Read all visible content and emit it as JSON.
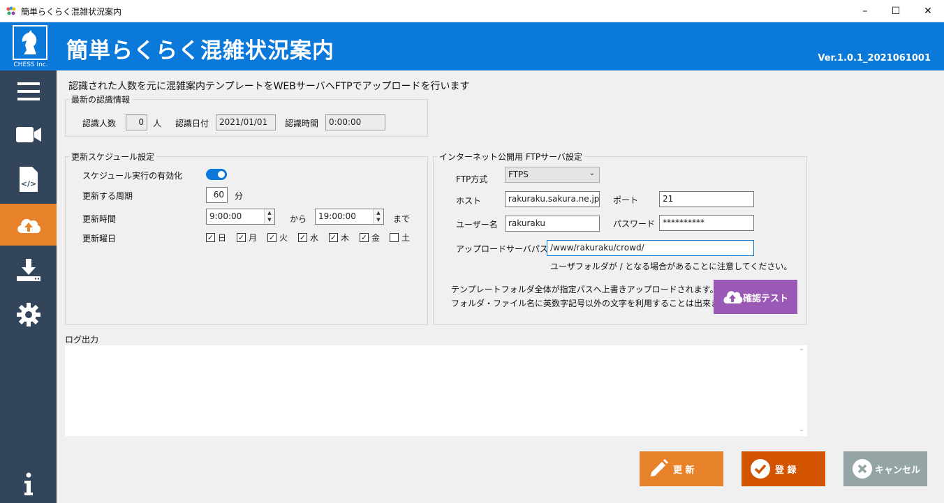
{
  "window": {
    "title": "簡単らくらく混雑状況案内",
    "minimize": "–",
    "maximize": "☐",
    "close": "✕"
  },
  "header": {
    "app_title": "簡単らくらく混雑状況案内",
    "logo_text": "CHESS Inc.",
    "version": "Ver.1.0.1_2021061001"
  },
  "sidebar": {
    "items": [
      {
        "icon": "menu-icon"
      },
      {
        "icon": "video-camera-icon"
      },
      {
        "icon": "code-file-icon"
      },
      {
        "icon": "cloud-upload-icon",
        "active": true
      },
      {
        "icon": "download-icon"
      },
      {
        "icon": "settings-gear-icon"
      },
      {
        "icon": "info-icon"
      }
    ]
  },
  "main": {
    "description": "認識された人数を元に混雑案内テンプレートをWEBサーバへFTPでアップロードを行います",
    "latest": {
      "group_label": "最新の認識情報",
      "count_label": "認識人数",
      "count_value": "0",
      "count_unit": "人",
      "date_label": "認識日付",
      "date_value": "2021/01/01",
      "time_label": "認識時間",
      "time_value": "0:00:00"
    },
    "schedule": {
      "group_label": "更新スケジュール設定",
      "enable_label": "スケジュール実行の有効化",
      "period_label": "更新する周期",
      "period_value": "60",
      "period_unit": "分",
      "time_label": "更新時間",
      "time_from": "9:00:00",
      "kara": "から",
      "time_to": "19:00:00",
      "made": "まで",
      "days_label": "更新曜日",
      "days": [
        {
          "label": "日",
          "checked": true
        },
        {
          "label": "月",
          "checked": true
        },
        {
          "label": "火",
          "checked": true
        },
        {
          "label": "水",
          "checked": true
        },
        {
          "label": "木",
          "checked": true
        },
        {
          "label": "金",
          "checked": true
        },
        {
          "label": "土",
          "checked": false
        }
      ]
    },
    "ftp": {
      "group_label": "インターネット公開用 FTPサーバ設定",
      "method_label": "FTP方式",
      "method_value": "FTPS",
      "host_label": "ホスト",
      "host_value": "rakuraku.sakura.ne.jp",
      "port_label": "ポート",
      "port_value": "21",
      "user_label": "ユーザー名",
      "user_value": "rakuraku",
      "password_label": "パスワード",
      "password_value": "**********",
      "path_label": "アップロードサーバパス",
      "path_value": "/www/rakuraku/crowd/",
      "path_note": "ユーザフォルダが / となる場合があることに注意してください。",
      "warning_line1": "テンプレートフォルダ全体が指定パスへ上書きアップロードされます。",
      "warning_line2": "フォルダ・ファイル名に英数字記号以外の文字を利用することは出来ません。",
      "test_button": "確認テスト"
    },
    "log": {
      "label": "ログ出力",
      "content": ""
    }
  },
  "buttons": {
    "update": "更 新",
    "register": "登 録",
    "cancel": "キャンセル"
  },
  "colors": {
    "header": "#0a79d9",
    "sidebar": "#32455a",
    "active": "#e8822a",
    "test_button": "#9b59b6",
    "update": "#e8822a",
    "register": "#d35400",
    "cancel": "#95a5a6"
  }
}
